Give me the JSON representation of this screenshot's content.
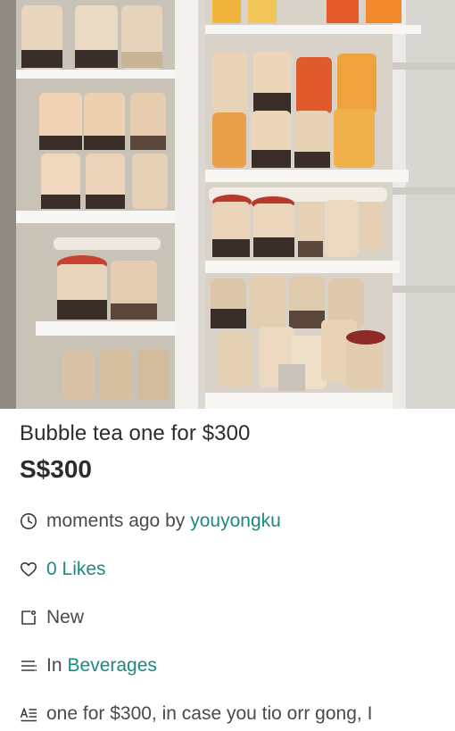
{
  "listing": {
    "title": "Bubble tea one for $300",
    "price": "S$300",
    "posted": {
      "time_text": "moments ago by",
      "seller": "youyongku",
      "icon": "clock-icon"
    },
    "likes": {
      "label": "0 Likes",
      "icon": "heart-icon"
    },
    "condition": {
      "label": "New",
      "icon": "tag-icon"
    },
    "category": {
      "prefix": "In",
      "name": "Beverages",
      "icon": "list-icon"
    },
    "description": {
      "text": "one for $300, in case you tio orr gong, I",
      "icon": "text-icon"
    }
  },
  "colors": {
    "accent": "#1a8a80",
    "text": "#2c2c2c",
    "muted": "#4a4a4a"
  }
}
